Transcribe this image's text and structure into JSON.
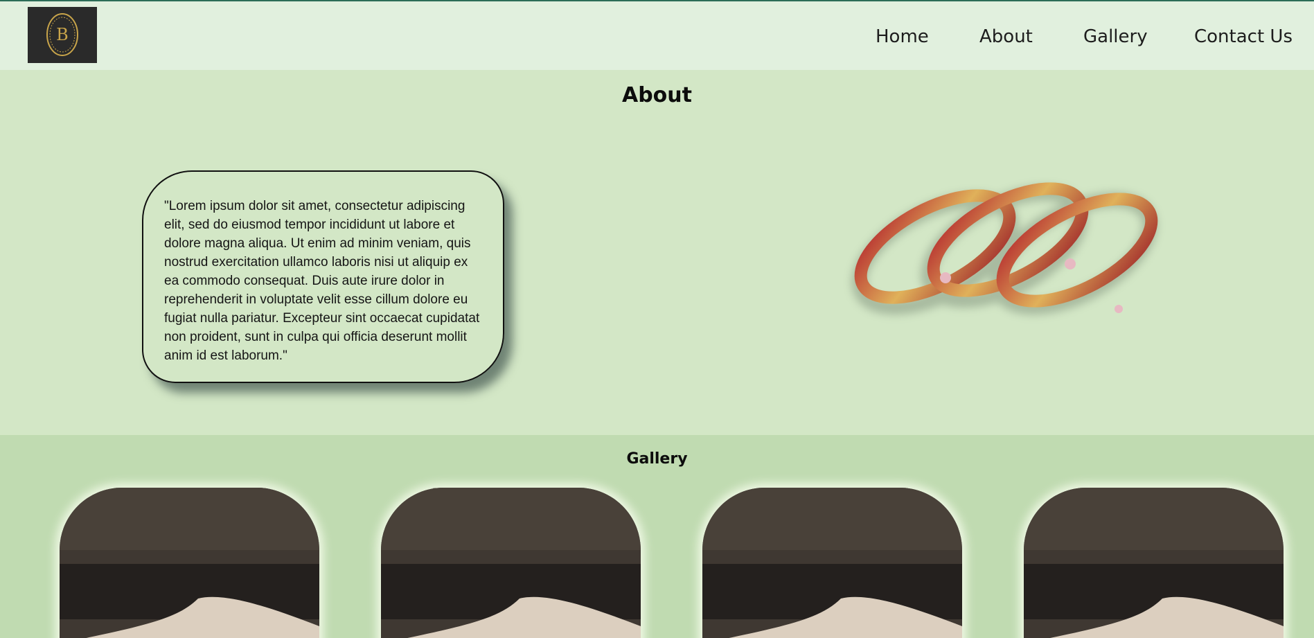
{
  "nav": {
    "logo_alt": "B",
    "links": [
      "Home",
      "About",
      "Gallery",
      "Contact Us"
    ]
  },
  "about": {
    "title": "About",
    "quote": "\"Lorem ipsum dolor sit amet, consectetur adipiscing elit, sed do eiusmod tempor incididunt ut labore et dolore magna aliqua. Ut enim ad minim veniam, quis nostrud exercitation ullamco laboris nisi ut aliquip ex ea commodo consequat. Duis aute irure dolor in reprehenderit in voluptate velit esse cillum dolore eu fugiat nulla pariatur. Excepteur sint occaecat cupidatat non proident, sunt in culpa qui officia deserunt mollit anim id est laborum.\""
  },
  "gallery": {
    "title": "Gallery",
    "item_count": 4
  },
  "colors": {
    "nav_bg": "#e1f0de",
    "about_bg": "#d3e7c6",
    "gallery_bg": "#c0dbb1",
    "logo_gold": "#c9a54a"
  }
}
